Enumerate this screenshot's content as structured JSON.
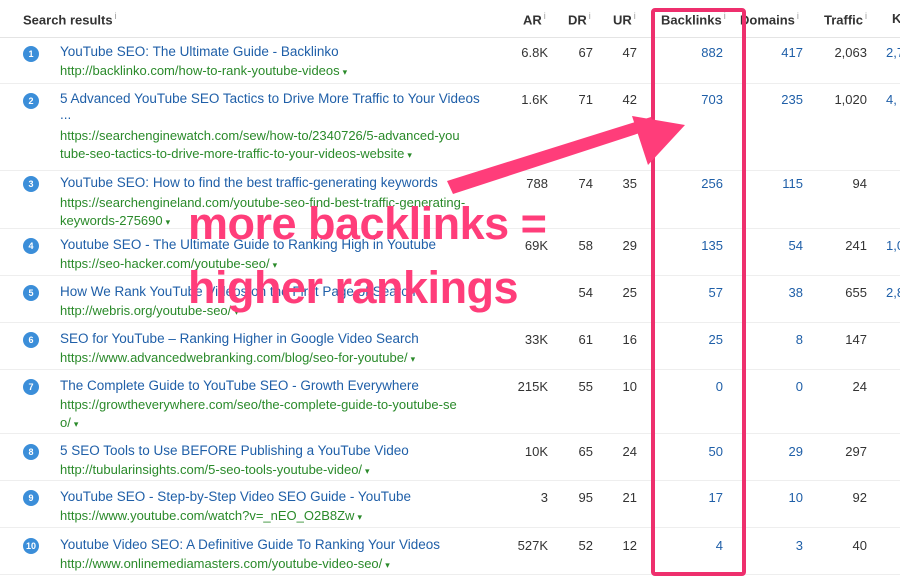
{
  "header": {
    "search_results": "Search results",
    "ar": "AR",
    "dr": "DR",
    "ur": "UR",
    "backlinks": "Backlinks",
    "domains": "Domains",
    "traffic": "Traffic",
    "kw": "K",
    "info_glyph": "i"
  },
  "rows": [
    {
      "rank": "1",
      "title": "YouTube SEO: The Ultimate Guide - Backlinko",
      "url": [
        "http://backlinko.com/how-to-rank-youtube-videos"
      ],
      "ar": "6.8K",
      "dr": "67",
      "ur": "47",
      "backlinks": "882",
      "domains": "417",
      "traffic": "2,063",
      "kw": "2,7"
    },
    {
      "rank": "2",
      "title": "5 Advanced YouTube SEO Tactics to Drive More Traffic to Your Videos",
      "title2": "...",
      "url": [
        "https://searchenginewatch.com/sew/how-to/2340726/5-advanced-you",
        "tube-seo-tactics-to-drive-more-traffic-to-your-videos-website"
      ],
      "ar": "1.6K",
      "dr": "71",
      "ur": "42",
      "backlinks": "703",
      "domains": "235",
      "traffic": "1,020",
      "kw": "4,"
    },
    {
      "rank": "3",
      "title": "YouTube SEO: How to find the best traffic-generating keywords",
      "url": [
        "https://searchengineland.com/youtube-seo-find-best-traffic-generating-",
        "keywords-275690"
      ],
      "ar": "788",
      "dr": "74",
      "ur": "35",
      "backlinks": "256",
      "domains": "115",
      "traffic": "94",
      "kw": ""
    },
    {
      "rank": "4",
      "title": "Youtube SEO - The Ultimate Guide to Ranking High in Youtube",
      "url": [
        "https://seo-hacker.com/youtube-seo/"
      ],
      "ar": "69K",
      "dr": "58",
      "ur": "29",
      "backlinks": "135",
      "domains": "54",
      "traffic": "241",
      "kw": "1,0"
    },
    {
      "rank": "5",
      "title": "How We Rank YouTube Videos on the First Page of Search",
      "url": [
        "http://webris.org/youtube-seo/"
      ],
      "ar": "",
      "dr": "54",
      "ur": "25",
      "backlinks": "57",
      "domains": "38",
      "traffic": "655",
      "kw": "2,8"
    },
    {
      "rank": "6",
      "title": "SEO for YouTube – Ranking Higher in Google Video Search",
      "url": [
        "https://www.advancedwebranking.com/blog/seo-for-youtube/"
      ],
      "ar": "33K",
      "dr": "61",
      "ur": "16",
      "backlinks": "25",
      "domains": "8",
      "traffic": "147",
      "kw": ""
    },
    {
      "rank": "7",
      "title": "The Complete Guide to YouTube SEO - Growth Everywhere",
      "url": [
        "https://growtheverywhere.com/seo/the-complete-guide-to-youtube-se",
        "o/"
      ],
      "ar": "215K",
      "dr": "55",
      "ur": "10",
      "backlinks": "0",
      "domains": "0",
      "traffic": "24",
      "kw": ""
    },
    {
      "rank": "8",
      "title": "5 SEO Tools to Use BEFORE Publishing a YouTube Video",
      "url": [
        "http://tubularinsights.com/5-seo-tools-youtube-video/"
      ],
      "ar": "10K",
      "dr": "65",
      "ur": "24",
      "backlinks": "50",
      "domains": "29",
      "traffic": "297",
      "kw": ""
    },
    {
      "rank": "9",
      "title": "YouTube SEO - Step-by-Step Video SEO Guide - YouTube",
      "url": [
        "https://www.youtube.com/watch?v=_nEO_O2B8Zw"
      ],
      "ar": "3",
      "dr": "95",
      "ur": "21",
      "backlinks": "17",
      "domains": "10",
      "traffic": "92",
      "kw": ""
    },
    {
      "rank": "10",
      "title": "Youtube Video SEO: A Definitive Guide To Ranking Your Videos",
      "url": [
        "http://www.onlinemediamasters.com/youtube-video-seo/"
      ],
      "ar": "527K",
      "dr": "52",
      "ur": "12",
      "backlinks": "4",
      "domains": "3",
      "traffic": "40",
      "kw": ""
    }
  ],
  "annotation": {
    "line1": "more backlinks =",
    "line2": "higher rankings",
    "color": "#ff3d7a"
  },
  "icons": {
    "url_arrow": "▾"
  }
}
